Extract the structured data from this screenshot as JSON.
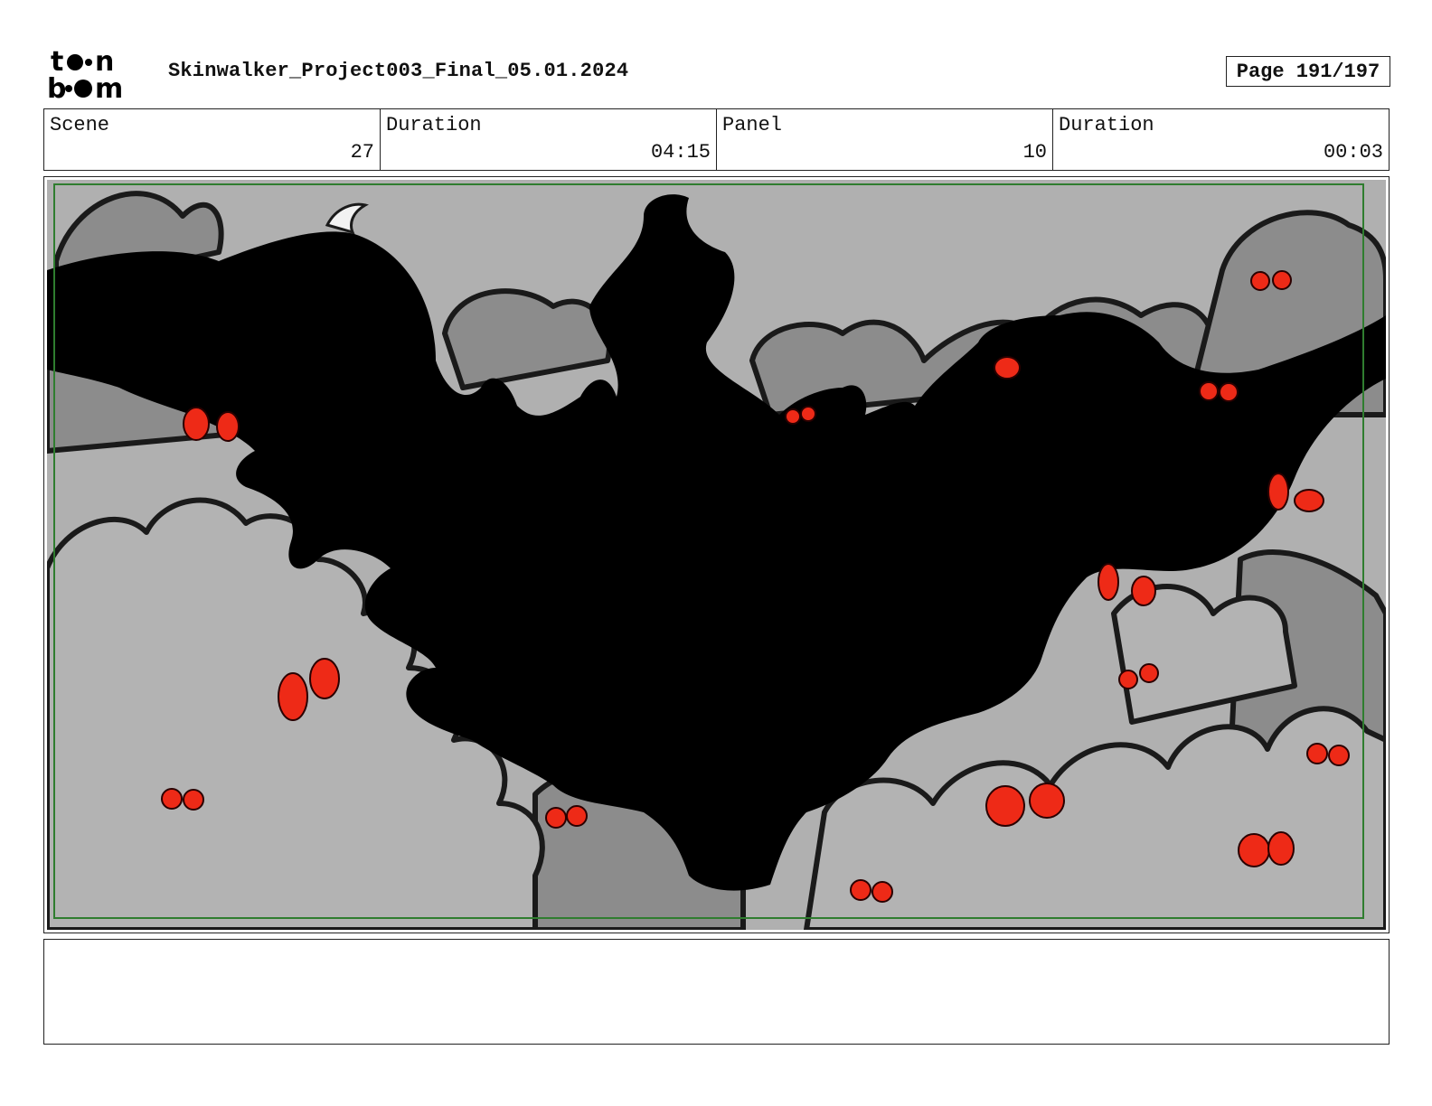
{
  "header": {
    "logo_text": "toon boom",
    "project_title": "Skinwalker_Project003_Final_05.01.2024",
    "page_label": "Page 191/197"
  },
  "info": {
    "scene_label": "Scene",
    "scene_value": "27",
    "scene_duration_label": "Duration",
    "scene_duration_value": "04:15",
    "panel_label": "Panel",
    "panel_value": "10",
    "panel_duration_label": "Duration",
    "panel_duration_value": "00:03"
  },
  "panel": {
    "colors": {
      "sky": "#b0b0b0",
      "bush_dark": "#8c8c8c",
      "bush_light": "#b3b3b3",
      "silhouette": "#000000",
      "eyes": "#ee2a17",
      "safe_frame": "#2f7d2f"
    }
  },
  "notes": {
    "text": ""
  }
}
